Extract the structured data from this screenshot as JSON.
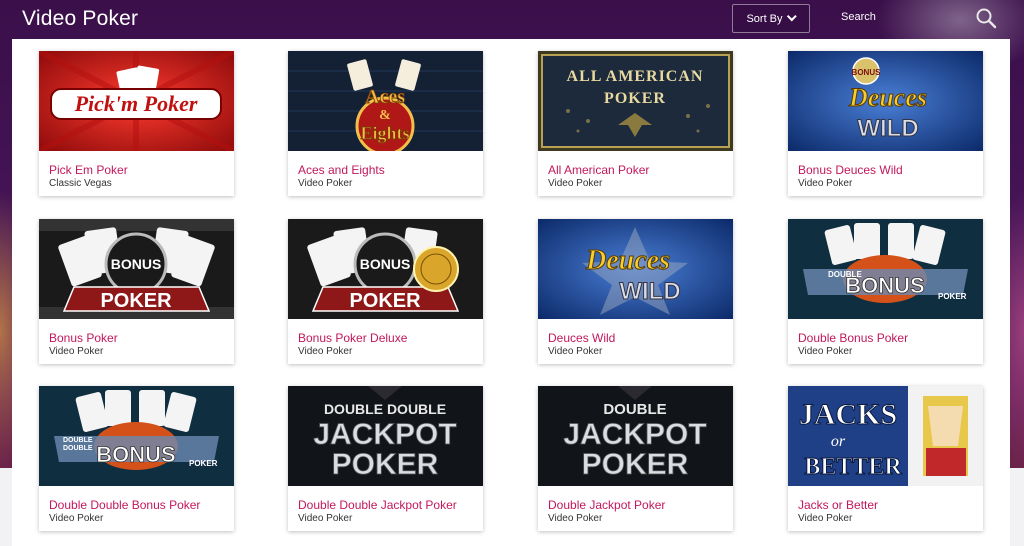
{
  "header": {
    "title": "Video Poker",
    "sort_label": "Sort By",
    "search_label": "Search"
  },
  "colors": {
    "title_pink": "#c2185b",
    "header_bg": "#3a0f4a"
  },
  "games": [
    {
      "title": "Pick Em Poker",
      "category": "Classic Vegas",
      "art": "Pick'm Poker",
      "icon": "pick-em-poker-thumbnail"
    },
    {
      "title": "Aces and Eights",
      "category": "Video Poker",
      "art": "Aces & Eights",
      "icon": "aces-and-eights-thumbnail"
    },
    {
      "title": "All American Poker",
      "category": "Video Poker",
      "art": "ALL AMERICAN POKER",
      "icon": "all-american-poker-thumbnail"
    },
    {
      "title": "Bonus Deuces Wild",
      "category": "Video Poker",
      "art": "Deuces WILD",
      "icon": "bonus-deuces-wild-thumbnail"
    },
    {
      "title": "Bonus Poker",
      "category": "Video Poker",
      "art": "BONUS POKER",
      "icon": "bonus-poker-thumbnail"
    },
    {
      "title": "Bonus Poker Deluxe",
      "category": "Video Poker",
      "art": "BONUS POKER",
      "icon": "bonus-poker-deluxe-thumbnail"
    },
    {
      "title": "Deuces Wild",
      "category": "Video Poker",
      "art": "Deuces WILD",
      "icon": "deuces-wild-thumbnail"
    },
    {
      "title": "Double Bonus Poker",
      "category": "Video Poker",
      "art": "BONUS",
      "icon": "double-bonus-poker-thumbnail"
    },
    {
      "title": "Double Double Bonus Poker",
      "category": "Video Poker",
      "art": "BONUS",
      "icon": "double-double-bonus-poker-thumbnail"
    },
    {
      "title": "Double Double Jackpot Poker",
      "category": "Video Poker",
      "art": "JACKPOT POKER",
      "icon": "double-double-jackpot-poker-thumbnail"
    },
    {
      "title": "Double Jackpot Poker",
      "category": "Video Poker",
      "art": "JACKPOT POKER",
      "icon": "double-jackpot-poker-thumbnail"
    },
    {
      "title": "Jacks or Better",
      "category": "Video Poker",
      "art": "JACKS or BETTER",
      "icon": "jacks-or-better-thumbnail"
    }
  ]
}
